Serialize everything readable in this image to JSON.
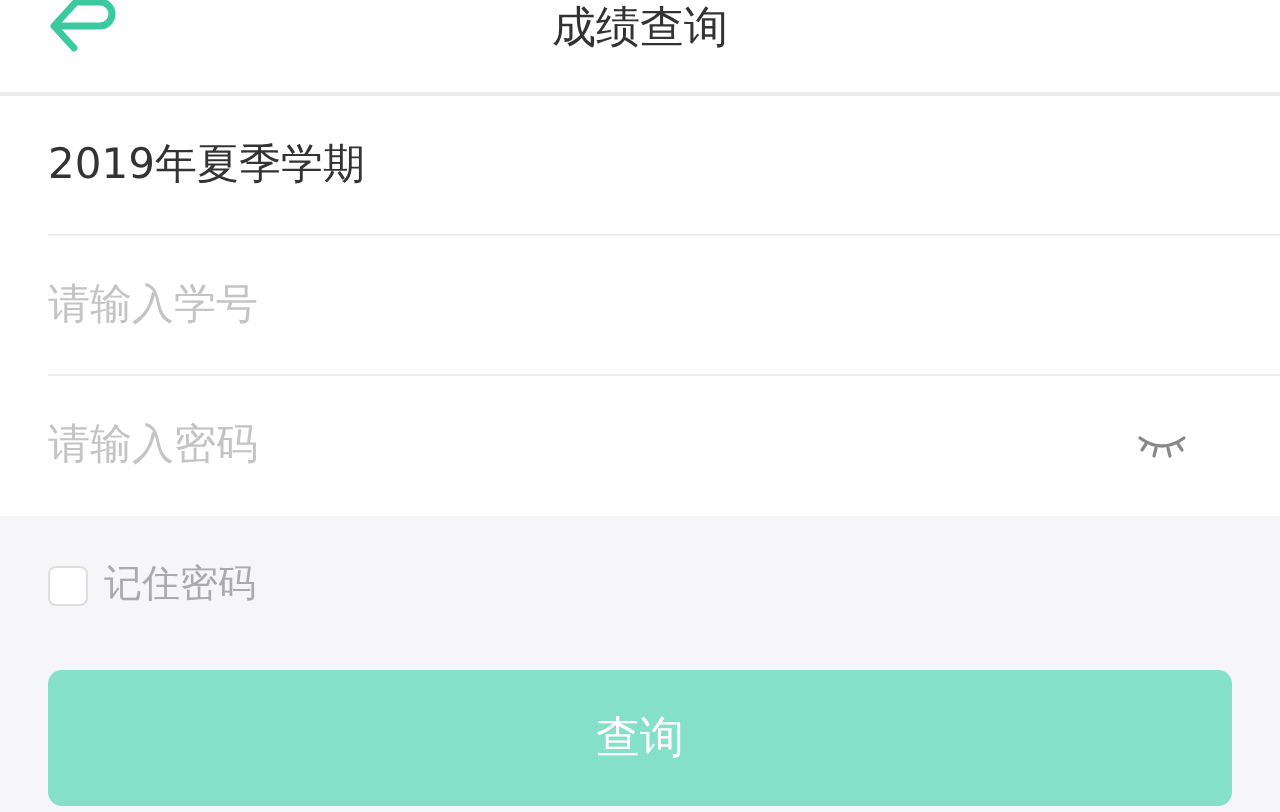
{
  "header": {
    "title": "成绩查询"
  },
  "term": {
    "value": "2019年夏季学期"
  },
  "fields": [
    {
      "kind": "text",
      "placeholder": "请输入学号"
    },
    {
      "kind": "password",
      "placeholder": "请输入密码",
      "reveal": false
    }
  ],
  "remember": {
    "label": "记住密码",
    "checked": false
  },
  "submit": {
    "label": "查询"
  }
}
